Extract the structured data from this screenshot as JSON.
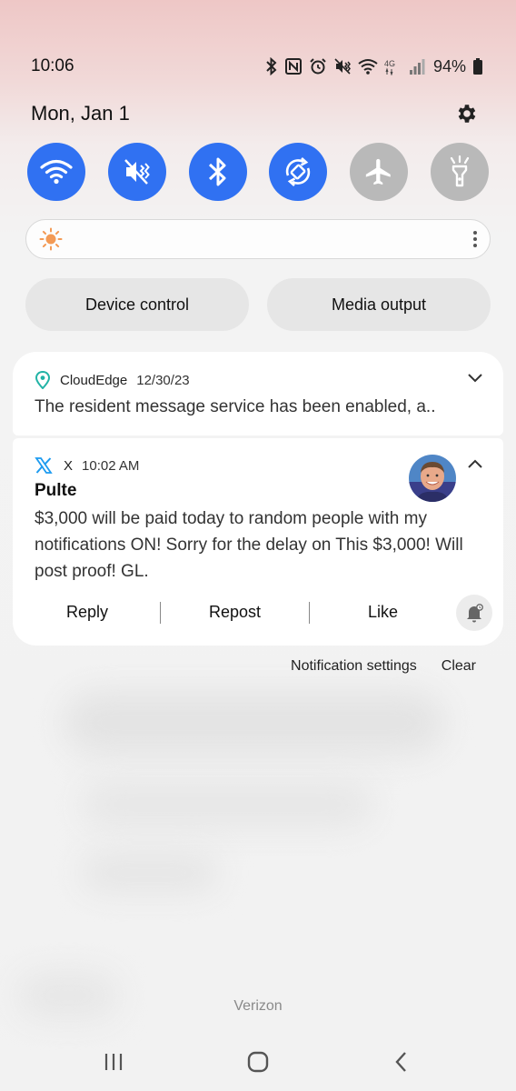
{
  "status_bar": {
    "time": "10:06",
    "battery": "94%",
    "icons": [
      "bluetooth-icon",
      "nfc-icon",
      "alarm-icon",
      "vibrate-icon",
      "wifi-icon",
      "4g-icon",
      "signal-icon",
      "battery-icon"
    ]
  },
  "header": {
    "date": "Mon, Jan 1",
    "settings_icon": "gear-icon"
  },
  "quick_toggles": [
    {
      "name": "wifi",
      "icon": "wifi-icon",
      "state": "on"
    },
    {
      "name": "sound",
      "icon": "vibrate-icon",
      "state": "on"
    },
    {
      "name": "bluetooth",
      "icon": "bluetooth-icon",
      "state": "on"
    },
    {
      "name": "auto-rotate",
      "icon": "rotate-icon",
      "state": "on"
    },
    {
      "name": "airplane-mode",
      "icon": "airplane-icon",
      "state": "off"
    },
    {
      "name": "flashlight",
      "icon": "flashlight-icon",
      "state": "off"
    }
  ],
  "brightness": {
    "icon": "sun-icon",
    "level": 0
  },
  "pills": {
    "device_control": "Device control",
    "media_output": "Media output"
  },
  "notifications": [
    {
      "app": "CloudEdge",
      "time": "12/30/23",
      "body": "The resident message service has been enabled, a..",
      "icon": "location-pin-icon"
    },
    {
      "app": "X",
      "time": "10:02 AM",
      "title": "Pulte",
      "body_lines": [
        "$3,000 will be paid today to random people with my",
        "notifications ON! Sorry for the delay on This $3,000! Will",
        "post proof! GL."
      ],
      "icon": "x-logo-icon",
      "actions": {
        "reply": "Reply",
        "repost": "Repost",
        "like": "Like"
      }
    }
  ],
  "footer_links": {
    "settings": "Notification settings",
    "clear": "Clear"
  },
  "carrier": "Verizon",
  "colors": {
    "toggle_on": "#3071f2",
    "toggle_off": "#b9b9b9",
    "card": "#ffffff"
  }
}
